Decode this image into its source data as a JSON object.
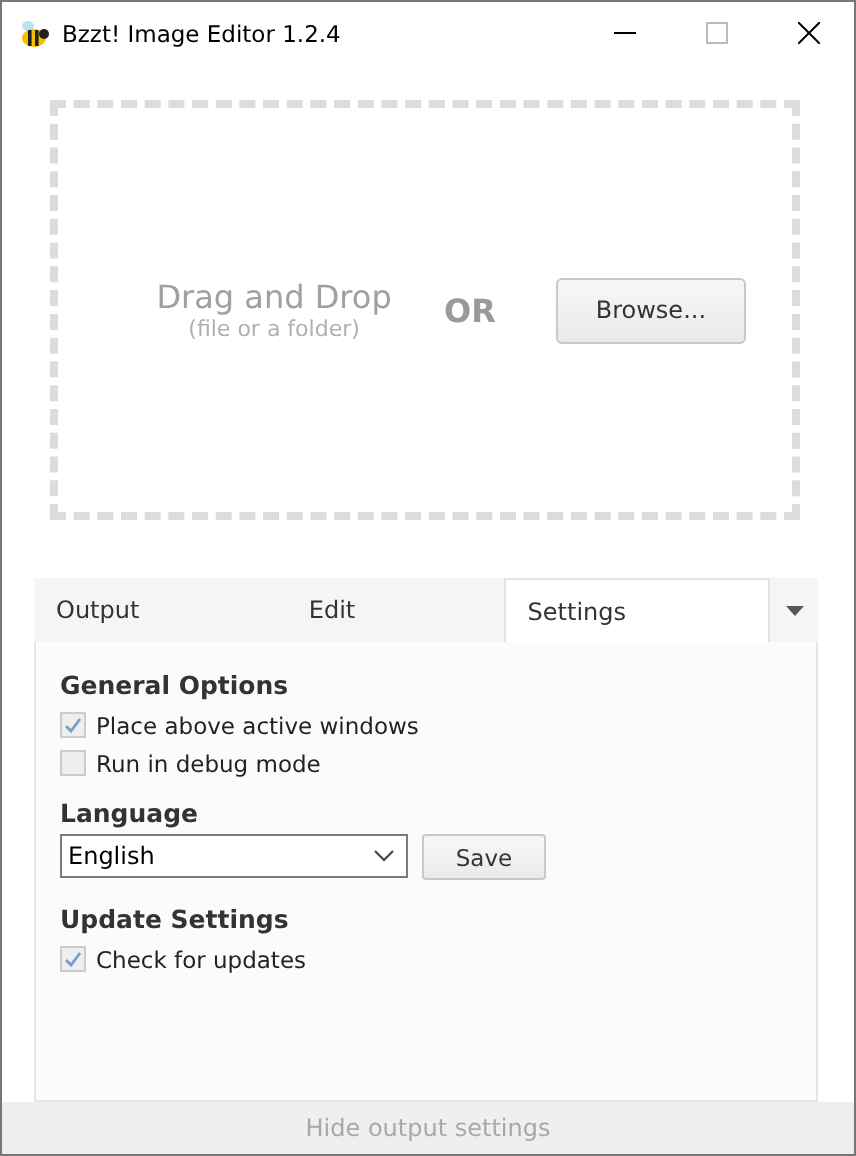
{
  "window": {
    "title": "Bzzt! Image Editor 1.2.4"
  },
  "drop_zone": {
    "title": "Drag and Drop",
    "hint": "(file or a folder)",
    "separator": "OR",
    "button": "Browse..."
  },
  "tabs": [
    {
      "label": "Output",
      "selected": false
    },
    {
      "label": "Edit",
      "selected": false
    },
    {
      "label": "Settings",
      "selected": true
    }
  ],
  "sections": [
    {
      "kind": "checkboxes",
      "title": "General Options",
      "options": [
        {
          "label": "Place above active windows",
          "checked": true
        },
        {
          "label": "Run in debug mode",
          "checked": false
        }
      ]
    },
    {
      "kind": "select",
      "title": "Language",
      "value": "English",
      "button": "Save"
    },
    {
      "kind": "checkboxes",
      "title": "Update Settings",
      "options": [
        {
          "label": "Check for updates",
          "checked": true
        }
      ]
    }
  ],
  "footer": {
    "label": "Hide output settings"
  }
}
